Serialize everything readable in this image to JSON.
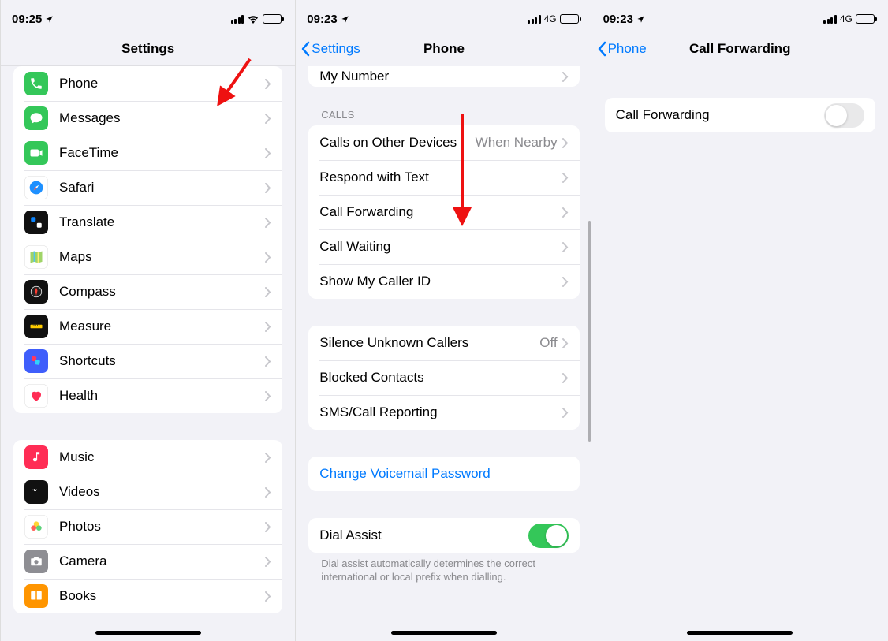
{
  "screen1": {
    "status": {
      "time": "09:25",
      "net": "wifi"
    },
    "title": "Settings",
    "group1": [
      {
        "icon": "phone",
        "bg": "#34c759",
        "label": "Phone"
      },
      {
        "icon": "messages",
        "bg": "#34c759",
        "label": "Messages"
      },
      {
        "icon": "facetime",
        "bg": "#34c759",
        "label": "FaceTime"
      },
      {
        "icon": "safari",
        "bg": "#fff",
        "label": "Safari"
      },
      {
        "icon": "translate",
        "bg": "#111",
        "label": "Translate"
      },
      {
        "icon": "maps",
        "bg": "#fff",
        "label": "Maps"
      },
      {
        "icon": "compass",
        "bg": "#111",
        "label": "Compass"
      },
      {
        "icon": "measure",
        "bg": "#111",
        "label": "Measure"
      },
      {
        "icon": "shortcuts",
        "bg": "#3f5efb",
        "label": "Shortcuts"
      },
      {
        "icon": "health",
        "bg": "#fff",
        "label": "Health"
      }
    ],
    "group2": [
      {
        "icon": "music",
        "bg": "#ff2d55",
        "label": "Music"
      },
      {
        "icon": "videos",
        "bg": "#111",
        "label": "Videos"
      },
      {
        "icon": "photos",
        "bg": "#fff",
        "label": "Photos"
      },
      {
        "icon": "camera",
        "bg": "#8e8e93",
        "label": "Camera"
      },
      {
        "icon": "books",
        "bg": "#ff9500",
        "label": "Books"
      }
    ]
  },
  "screen2": {
    "status": {
      "time": "09:23",
      "net": "4G"
    },
    "back": "Settings",
    "title": "Phone",
    "partial_row_label": "My Number",
    "calls_header": "CALLS",
    "calls": [
      {
        "label": "Calls on Other Devices",
        "detail": "When Nearby"
      },
      {
        "label": "Respond with Text"
      },
      {
        "label": "Call Forwarding"
      },
      {
        "label": "Call Waiting"
      },
      {
        "label": "Show My Caller ID"
      }
    ],
    "misc": [
      {
        "label": "Silence Unknown Callers",
        "detail": "Off"
      },
      {
        "label": "Blocked Contacts"
      },
      {
        "label": "SMS/Call Reporting"
      }
    ],
    "voicemail": {
      "label": "Change Voicemail Password"
    },
    "dial_assist": {
      "label": "Dial Assist",
      "on": true
    },
    "dial_assist_footer": "Dial assist automatically determines the correct international or local prefix when dialling."
  },
  "screen3": {
    "status": {
      "time": "09:23",
      "net": "4G"
    },
    "back": "Phone",
    "title": "Call Forwarding",
    "row": {
      "label": "Call Forwarding",
      "on": false
    }
  }
}
